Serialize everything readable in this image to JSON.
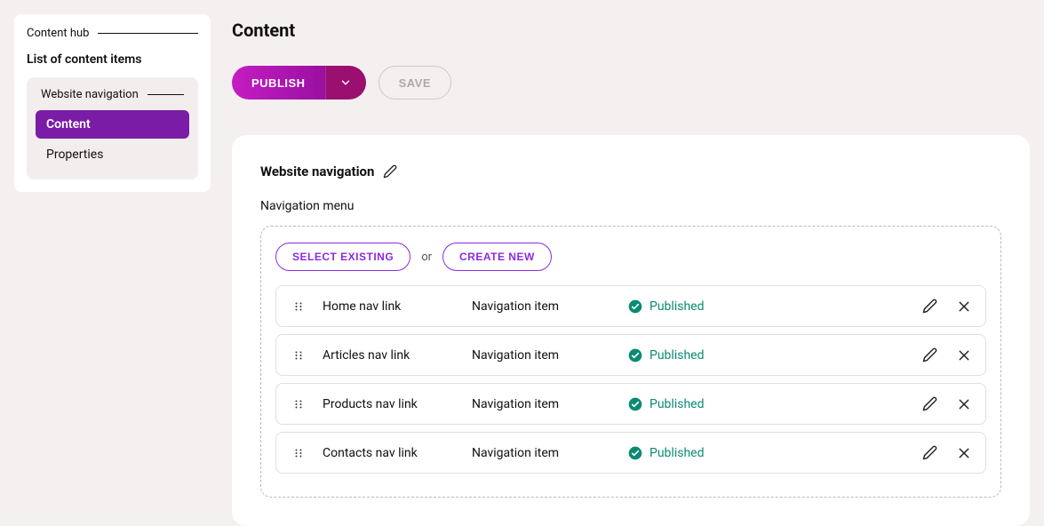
{
  "sidebar": {
    "breadcrumb": "Content hub",
    "listHeader": "List of content items",
    "group": {
      "label": "Website navigation",
      "items": [
        {
          "label": "Content",
          "active": true
        },
        {
          "label": "Properties",
          "active": false
        }
      ]
    }
  },
  "page": {
    "title": "Content",
    "publishLabel": "PUBLISH",
    "saveLabel": "SAVE"
  },
  "card": {
    "title": "Website navigation",
    "fieldLabel": "Navigation menu",
    "selectExistingLabel": "SELECT EXISTING",
    "orLabel": "or",
    "createNewLabel": "CREATE NEW",
    "items": [
      {
        "name": "Home nav link",
        "type": "Navigation item",
        "status": "Published"
      },
      {
        "name": "Articles nav link",
        "type": "Navigation item",
        "status": "Published"
      },
      {
        "name": "Products nav link",
        "type": "Navigation item",
        "status": "Published"
      },
      {
        "name": "Contacts nav link",
        "type": "Navigation item",
        "status": "Published"
      }
    ]
  },
  "colors": {
    "accent": "#8a2be2",
    "statusGreen": "#0a8a73"
  }
}
